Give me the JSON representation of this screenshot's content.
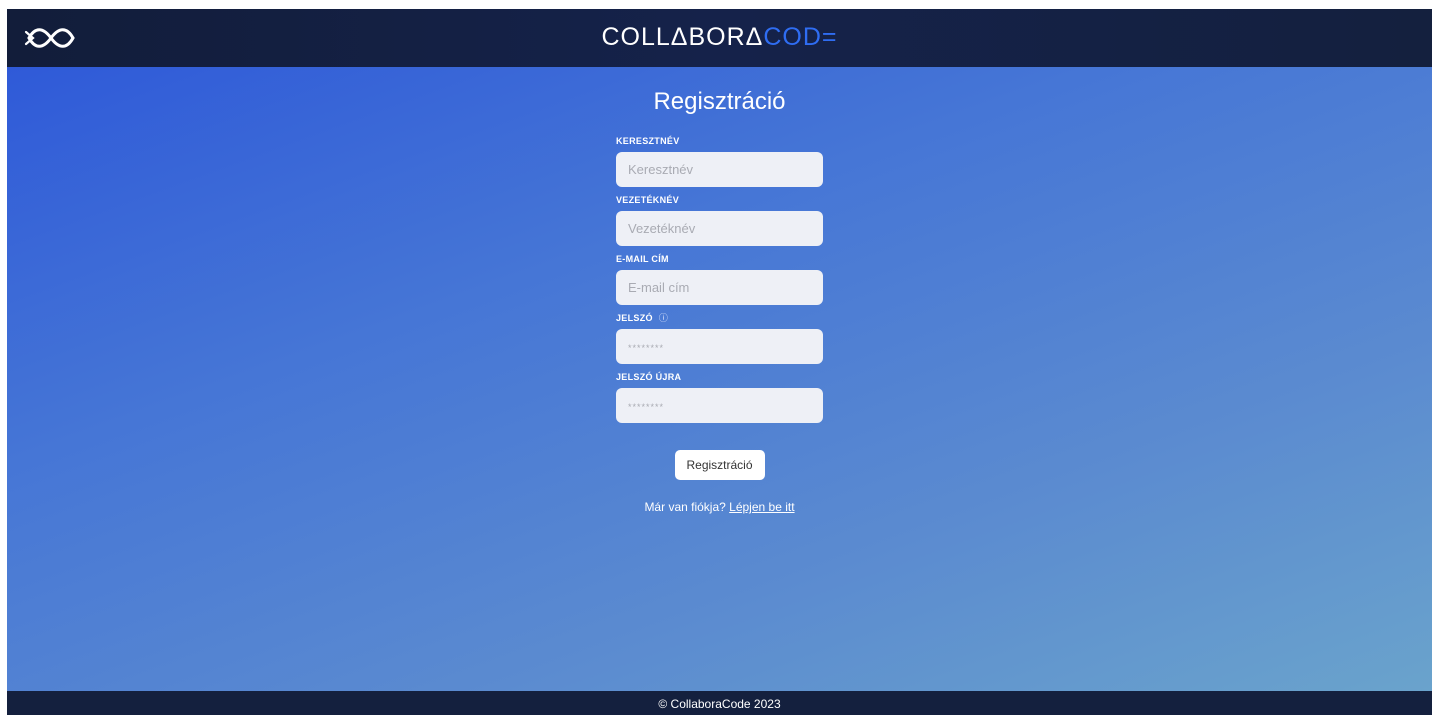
{
  "header": {
    "logo_icon": "infinity-logo-icon",
    "brand_part1": "COLLΔBORΔ",
    "brand_part2": "COD=",
    "colors": {
      "bar": "#14203e",
      "accent": "#2f6df2"
    }
  },
  "form": {
    "title": "Regisztráció",
    "fields": [
      {
        "label": "KERESZTNÉV",
        "placeholder": "Keresztnév"
      },
      {
        "label": "VEZETÉKNÉV",
        "placeholder": "Vezetéknév"
      },
      {
        "label": "E-MAIL CÍM",
        "placeholder": "E-mail cím"
      },
      {
        "label": "JELSZÓ",
        "placeholder": "********",
        "info_icon": "ⓘ"
      },
      {
        "label": "JELSZÓ ÚJRA",
        "placeholder": "********"
      }
    ],
    "submit_label": "Regisztráció",
    "login_prompt": "Már van fiókja?",
    "login_link": "Lépjen be itt"
  },
  "footer": {
    "text": "© CollaboraCode 2023"
  }
}
